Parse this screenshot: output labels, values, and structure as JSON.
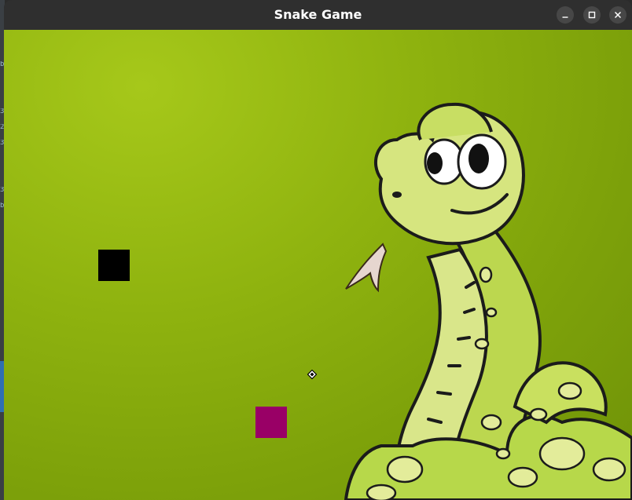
{
  "window": {
    "title": "Snake Game"
  },
  "controls": {
    "minimize": "minimize-icon",
    "maximize": "maximize-icon",
    "close": "close-icon"
  },
  "game": {
    "snake_color": "#000000",
    "food_color": "#990066",
    "background_color": "#8fb30f"
  }
}
